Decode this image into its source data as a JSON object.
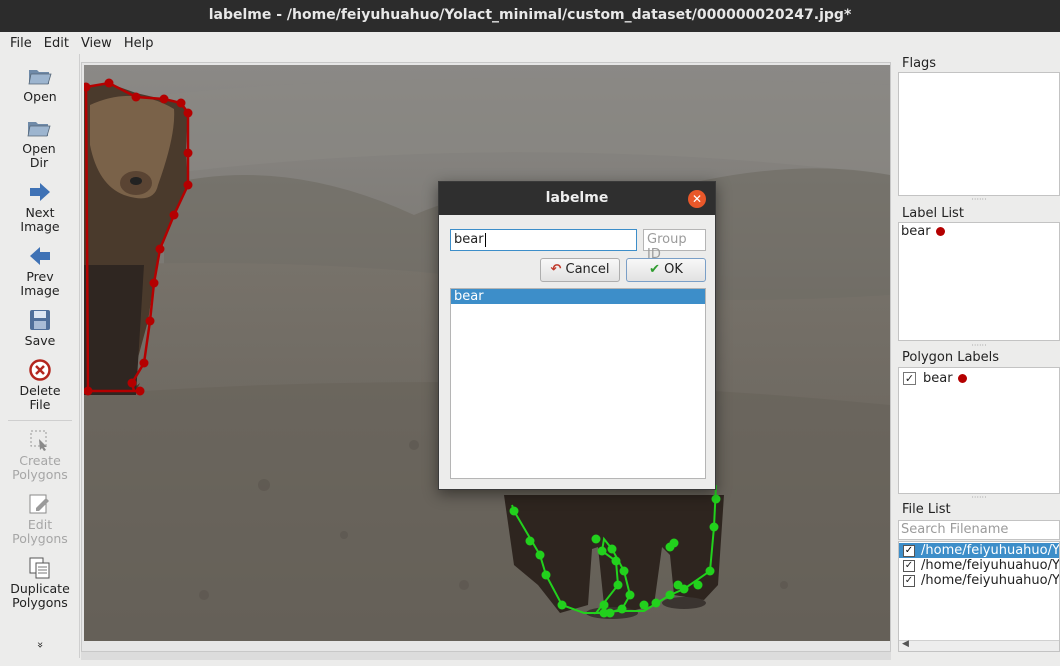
{
  "window": {
    "title": "labelme - /home/feiyuhuahuo/Yolact_minimal/custom_dataset/000000020247.jpg*"
  },
  "menu": [
    "File",
    "Edit",
    "View",
    "Help"
  ],
  "toolbar": {
    "open": "Open",
    "open_dir": "Open Dir",
    "next_image": "Next Image",
    "prev_image": "Prev Image",
    "save": "Save",
    "delete_file": "Delete File",
    "create_polygons": "Create Polygons",
    "edit_polygons": "Edit Polygons",
    "duplicate_polygons": "Duplicate Polygons",
    "more": "»"
  },
  "docks": {
    "flags": {
      "title": "Flags"
    },
    "label_list": {
      "title": "Label List",
      "items": [
        {
          "label": "bear",
          "color": "#b40000"
        }
      ]
    },
    "polygon_labels": {
      "title": "Polygon Labels",
      "items": [
        {
          "label": "bear",
          "checked": true,
          "color": "#b40000"
        }
      ]
    },
    "file_list": {
      "title": "File List",
      "search_placeholder": "Search Filename",
      "files": [
        {
          "path": "/home/feiyuhuahuo/Yolact",
          "checked": true,
          "selected": true
        },
        {
          "path": "/home/feiyuhuahuo/Yolact",
          "checked": true,
          "selected": false
        },
        {
          "path": "/home/feiyuhuahuo/Yolact",
          "checked": true,
          "selected": false
        }
      ]
    }
  },
  "dialog": {
    "title": "labelme",
    "label_value": "bear",
    "group_id_placeholder": "Group ID",
    "cancel_label": "Cancel",
    "ok_label": "OK",
    "label_options": [
      {
        "label": "bear",
        "selected": true
      }
    ]
  },
  "colors": {
    "accent": "#3d8ec9",
    "polygon_red": "#b40000",
    "polygon_green": "#22d11d",
    "close_button": "#e9582a"
  }
}
